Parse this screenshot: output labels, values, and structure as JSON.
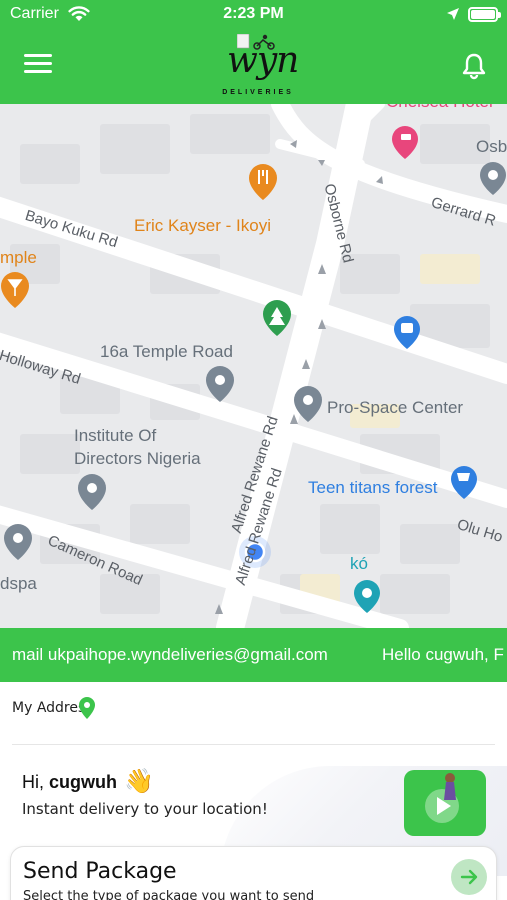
{
  "status_bar": {
    "carrier": "Carrier",
    "time": "2:23 PM"
  },
  "header": {
    "logo_text": "wyn",
    "logo_sub": "DELIVERIES",
    "menu_icon": "hamburger-menu-icon",
    "bell_icon": "bell-icon"
  },
  "map": {
    "places": [
      {
        "name": "Chelsea Hotel",
        "label": "Chelsea Hotel"
      },
      {
        "name": "osb",
        "label": "Osb"
      },
      {
        "name": "eric-kayser",
        "label": "Eric Kayser - Ikoyi"
      },
      {
        "name": "temple",
        "label": "mple"
      },
      {
        "name": "16a-temple-road",
        "label": "16a Temple Road"
      },
      {
        "name": "pro-space-center",
        "label": "Pro-Space Center"
      },
      {
        "name": "institute-line1",
        "label": "Institute Of"
      },
      {
        "name": "institute-line2",
        "label": "Directors Nigeria"
      },
      {
        "name": "teen-titans-forest",
        "label": "Teen titans forest"
      },
      {
        "name": "ko",
        "label": "kó"
      },
      {
        "name": "dspa",
        "label": "dspa"
      }
    ],
    "streets": [
      {
        "name": "bayo-kuku-rd",
        "label": "Bayo Kuku Rd"
      },
      {
        "name": "holloway-rd",
        "label": "Holloway Rd"
      },
      {
        "name": "osborne-rd",
        "label": "Osborne Rd"
      },
      {
        "name": "gerrard-r",
        "label": "Gerrard R"
      },
      {
        "name": "alfred-rewane-rd-1",
        "label": "Alfred Rewane Rd"
      },
      {
        "name": "alfred-rewane-rd-2",
        "label": "Alfred Rewane Rd"
      },
      {
        "name": "olu-ho",
        "label": "Olu Ho"
      },
      {
        "name": "cameron-road",
        "label": "Cameron Road"
      }
    ]
  },
  "marquee": {
    "text_1": "mail ukpaihope.wyndeliveries@gmail.com",
    "text_2": "Hello cugwuh, F"
  },
  "address": {
    "label": "My Address"
  },
  "greeting": {
    "hi": "Hi,",
    "username": "cugwuh",
    "wave": "👋",
    "subtitle": "Instant delivery to your location!"
  },
  "send_package": {
    "title": "Send Package",
    "subtitle": "Select the type of package you want to send"
  },
  "colors": {
    "brand_green": "#3cc44b",
    "map_bg": "#e9eaec",
    "poi_orange": "#e98a1f",
    "poi_blue": "#2f7fe0"
  }
}
